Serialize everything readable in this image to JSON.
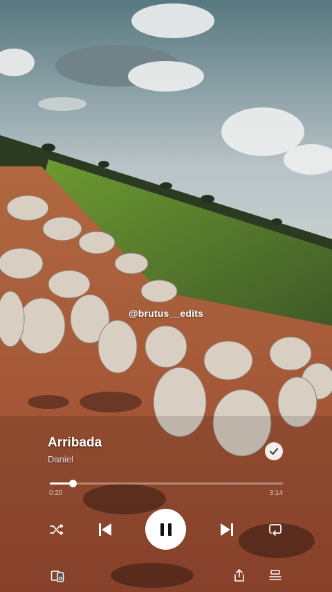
{
  "watermark": "@brutus__edits",
  "player": {
    "track_title": "Arribada",
    "artist": "Daniel",
    "elapsed": "0:20",
    "duration": "3:14",
    "progress": 0.1,
    "liked": true
  },
  "controls": {
    "shuffle": "shuffle-icon",
    "previous": "skip-previous-icon",
    "play_pause": "pause-icon",
    "next": "skip-next-icon",
    "repeat": "repeat-icon",
    "device": "connect-device-icon",
    "share": "share-icon",
    "queue": "queue-icon"
  },
  "colors": {
    "sky_top": "#5f7f86",
    "sky_mid": "#c9d0d2",
    "field_green": "#5f8a2e",
    "dirt": "#a85a3c",
    "cattle": "#d6ccbf"
  }
}
